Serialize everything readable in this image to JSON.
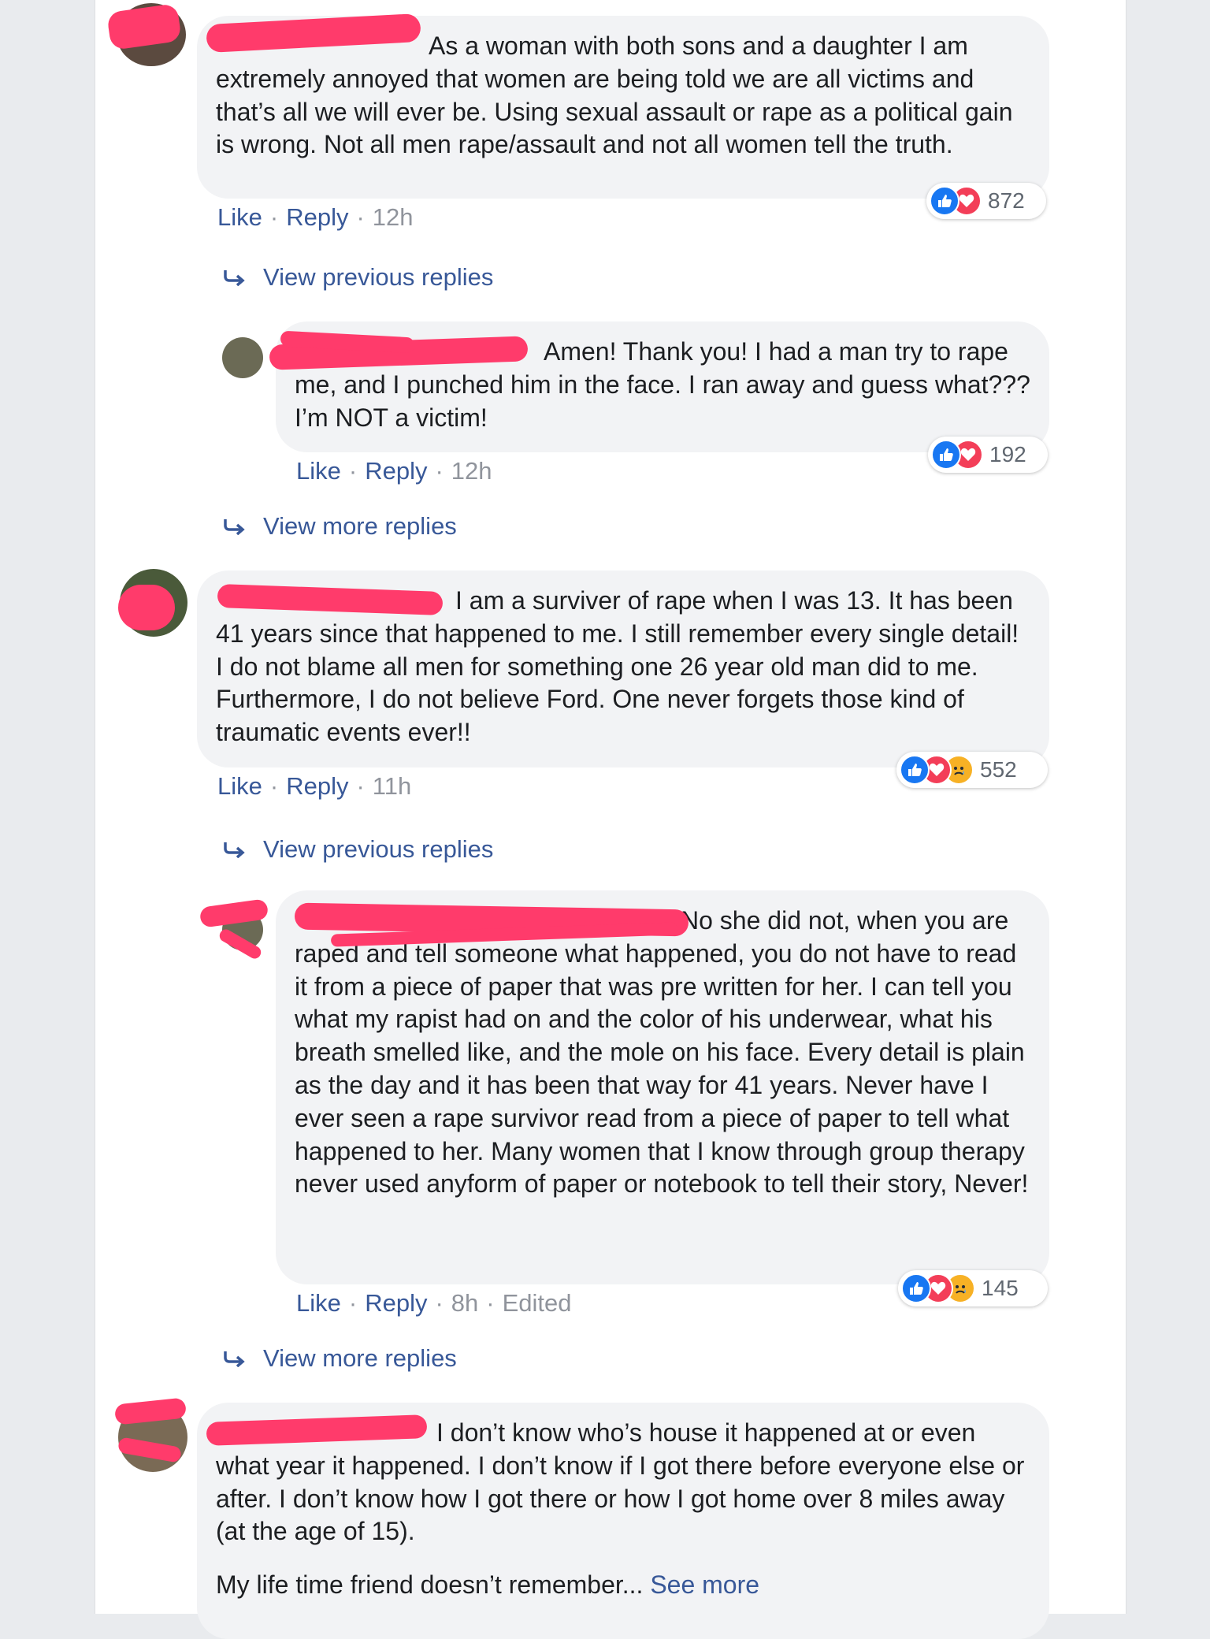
{
  "comments": [
    {
      "text": "As a woman with both sons and a daughter I am extremely annoyed that women are being told we are all victims and that’s all we will ever be. Using sexual assault or rape as a political gain is wrong. Not all men rape/assault and not all women tell the truth.",
      "actions": {
        "like": "Like",
        "reply": "Reply",
        "time": "12h"
      },
      "reaction_count": "872",
      "reactions": [
        "like-icon",
        "love-icon"
      ]
    },
    {
      "text": "Amen! Thank you! I had a man try to rape me, and I punched him in the face. I ran away and guess what??? I’m NOT a victim!",
      "actions": {
        "like": "Like",
        "reply": "Reply",
        "time": "12h"
      },
      "reaction_count": "192",
      "reactions": [
        "like-icon",
        "love-icon"
      ]
    },
    {
      "text": "I am a surviver of rape when I was 13. It has been 41 years since that happened to me. I still remember every single detail! I do not blame all men for something one 26 year old man did to me. Furthermore, I do not believe Ford. One never forgets those kind of traumatic events ever!!",
      "actions": {
        "like": "Like",
        "reply": "Reply",
        "time": "11h"
      },
      "reaction_count": "552",
      "reactions": [
        "like-icon",
        "love-icon",
        "sad-icon"
      ]
    },
    {
      "text": "No she did not, when you are raped and tell someone what happened, you do not have to read it from a piece of paper that was pre written for her. I can tell you what my rapist had on and the color of his underwear, what his breath smelled like, and the mole on his face. Every detail is plain as the day and it has been that way for 41 years. Never have I ever seen a rape survivor read from a piece of paper to tell what happened to her. Many women that I know through group therapy never used anyform of paper or notebook to tell their story, Never!",
      "actions": {
        "like": "Like",
        "reply": "Reply",
        "time": "8h",
        "edited": "Edited"
      },
      "reaction_count": "145",
      "reactions": [
        "like-icon",
        "love-icon",
        "sad-icon"
      ]
    },
    {
      "text": "I don’t know who’s house it happened at or even what year it happened. I don’t know if I got there before everyone else or after. I don’t know how I got there or how I got home over 8 miles away (at the age of 15).",
      "text2": "My life time friend doesn’t remember...",
      "see_more": "See more"
    }
  ],
  "links": {
    "view_previous": "View previous replies",
    "view_more": "View more replies"
  },
  "colors": {
    "link": "#385898",
    "redaction": "#ff3b6b",
    "bubble": "#f2f3f5",
    "like": "#1877f2",
    "love": "#f33e58",
    "sad": "#f7b125"
  }
}
